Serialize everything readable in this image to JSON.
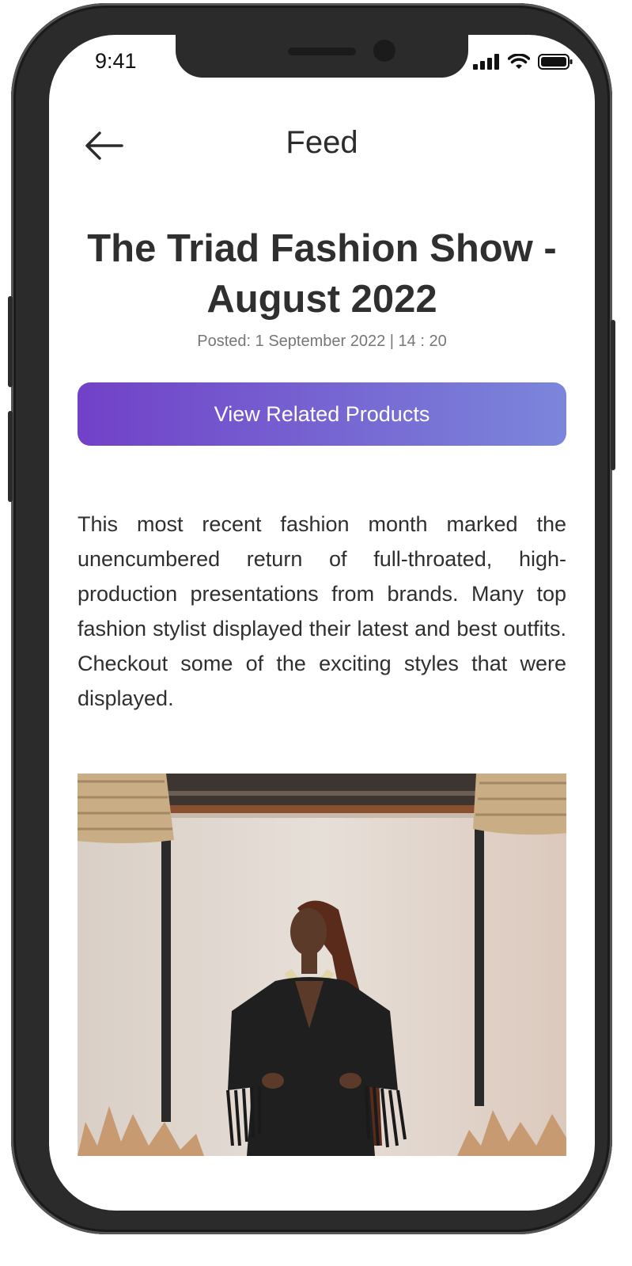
{
  "status_bar": {
    "time": "9:41"
  },
  "header": {
    "title": "Feed"
  },
  "post": {
    "title": "The Triad Fashion Show - August 2022",
    "meta": "Posted: 1 September 2022 | 14 : 20",
    "cta_label": "View Related Products",
    "body": "This most recent fashion month marked the unencumbered return of full-throated, high-production presentations from brands. Many top fashion stylist displayed their latest and best outfits. Checkout some of the exciting styles that were displayed."
  },
  "colors": {
    "gradient_start": "#7141c8",
    "gradient_end": "#7b86db",
    "text": "#2f2f2f"
  }
}
